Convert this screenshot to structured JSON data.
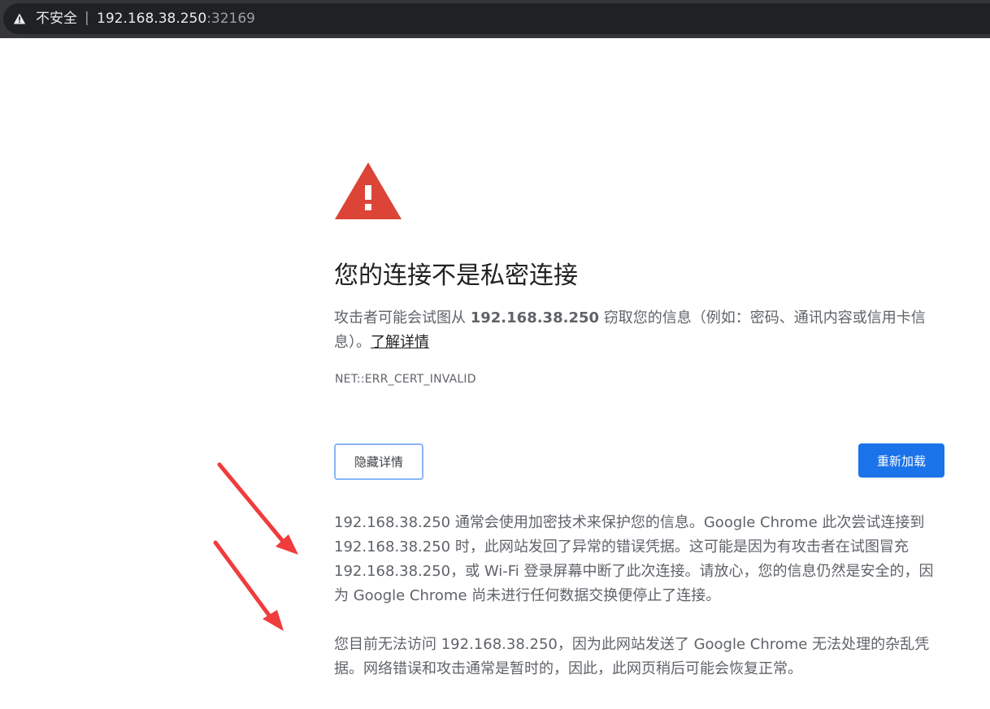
{
  "address_bar": {
    "security_label": "不安全",
    "separator": "|",
    "url_host": "192.168.38.250",
    "url_port": ":32169"
  },
  "interstitial": {
    "title": "您的连接不是私密连接",
    "explanation_prefix": "攻击者可能会试图从 ",
    "explanation_host": "192.168.38.250",
    "explanation_suffix": " 窃取您的信息（例如：密码、通讯内容或信用卡信息）。",
    "learn_more": "了解详情",
    "error_code": "NET::ERR_CERT_INVALID",
    "hide_details_button": "隐藏详情",
    "reload_button": "重新加载",
    "details_paragraph_1": "192.168.38.250 通常会使用加密技术来保护您的信息。Google Chrome 此次尝试连接到 192.168.38.250 时，此网站发回了异常的错误凭据。这可能是因为有攻击者在试图冒充 192.168.38.250，或 Wi-Fi 登录屏幕中断了此次连接。请放心，您的信息仍然是安全的，因为 Google Chrome 尚未进行任何数据交换便停止了连接。",
    "details_paragraph_2": "您目前无法访问 192.168.38.250，因为此网站发送了 Google Chrome 无法处理的杂乱凭据。网络错误和攻击通常是暂时的，因此，此网页稍后可能会恢复正常。"
  },
  "icons": {
    "address_warning": "warning-triangle-icon",
    "page_warning": "warning-triangle-icon",
    "annotations": "red-arrow-icon"
  },
  "colors": {
    "warning_red": "#db4437",
    "reload_blue": "#1a73e8",
    "topbar": "#35363a",
    "annotation_red": "#f03c3c"
  }
}
